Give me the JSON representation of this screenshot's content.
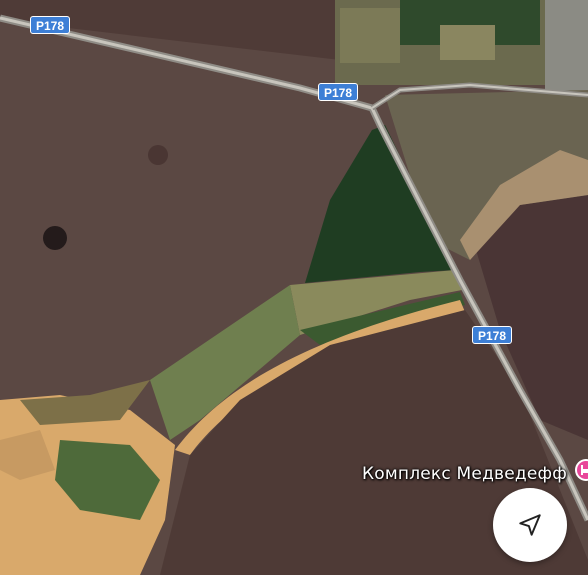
{
  "map": {
    "type": "satellite",
    "roads": [
      {
        "shield": "P178"
      },
      {
        "shield": "P178"
      },
      {
        "shield": "P178"
      }
    ],
    "poi": {
      "label": "Комплекс Медведефф",
      "icon": "hotel-pin-icon",
      "pin_color": "#e8479a"
    },
    "controls": {
      "navigate_icon": "navigation-arrow-icon"
    },
    "colors": {
      "field": "#5b4843",
      "forest": "#1f3d22",
      "sand": "#d9a96b",
      "road": "#b7b4ad",
      "shield": "#3d7fd6"
    }
  }
}
